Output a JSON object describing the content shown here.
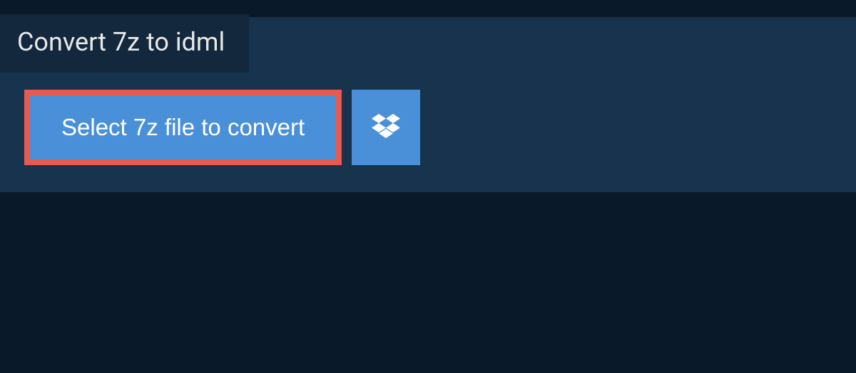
{
  "tab": {
    "title": "Convert 7z to idml"
  },
  "buttons": {
    "select_label": "Select 7z file to convert"
  },
  "colors": {
    "page_bg": "#0a1929",
    "panel_bg": "#17334d",
    "tab_bg": "#13283d",
    "button_bg": "#4a90d9",
    "highlight_border": "#e85a4f"
  },
  "icons": {
    "dropbox": "dropbox-icon"
  }
}
